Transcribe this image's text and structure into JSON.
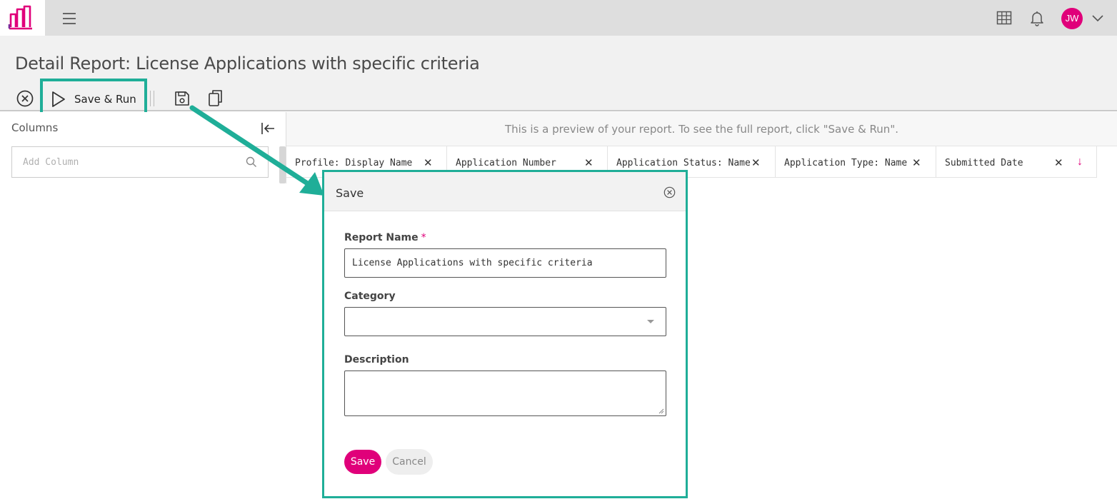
{
  "app": {
    "logo_icon": "brand-logo-icon",
    "accent_color": "#e0007a",
    "highlight_color": "#1fae98"
  },
  "topbar": {
    "menu_icon": "hamburger-menu-icon",
    "grid_icon": "apps-grid-icon",
    "bell_icon": "notification-bell-icon",
    "avatar_initials": "JW",
    "chevron_icon": "chevron-down-icon"
  },
  "page": {
    "title": "Detail Report: License Applications with specific criteria"
  },
  "toolbar": {
    "close_icon": "close-circle-icon",
    "save_run_label": "Save & Run",
    "save_icon": "floppy-disk-icon",
    "copy_icon": "copy-icon"
  },
  "sidebar": {
    "columns_label": "Columns",
    "add_column_placeholder": "Add Column"
  },
  "preview": {
    "message": "This is a preview of your report. To see the full report, click \"Save & Run\".",
    "columns": [
      {
        "name": "Profile: Display Name"
      },
      {
        "name": "Application Number"
      },
      {
        "name": "Application Status: Name"
      },
      {
        "name": "Application Type: Name"
      },
      {
        "name": "Submitted Date"
      }
    ],
    "remove_glyph": "✕",
    "sort_glyph": "↓"
  },
  "modal": {
    "title": "Save",
    "report_name_label": "Report Name",
    "required_mark": "*",
    "report_name_value": "License Applications with specific criteria",
    "category_label": "Category",
    "category_value": "",
    "description_label": "Description",
    "description_value": "",
    "save_label": "Save",
    "cancel_label": "Cancel"
  }
}
